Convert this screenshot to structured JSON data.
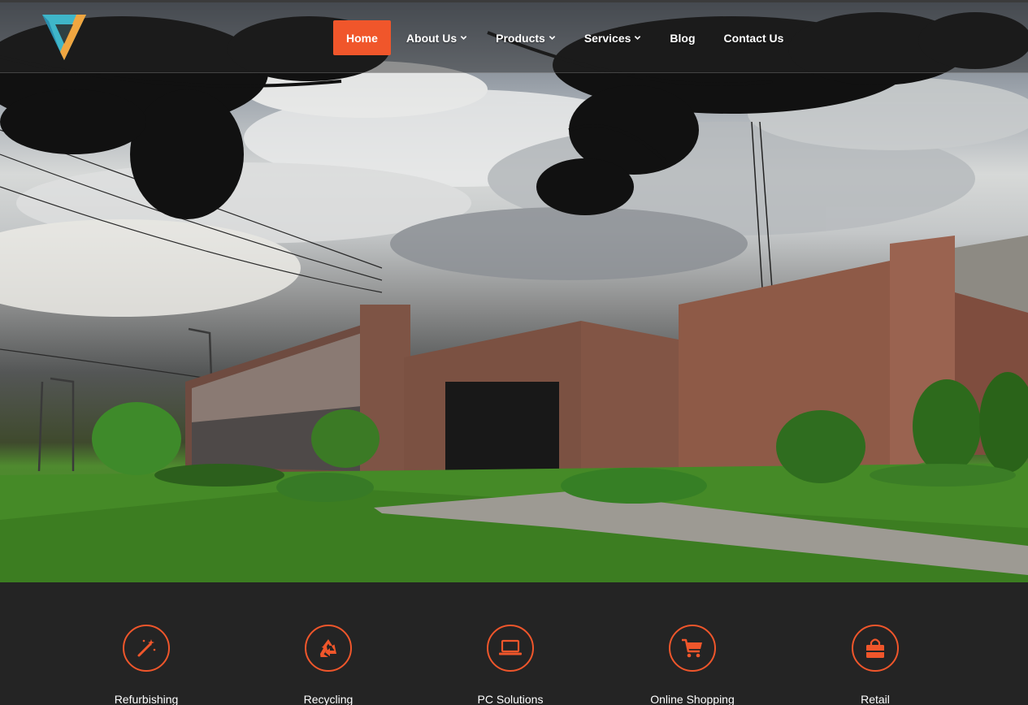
{
  "header": {
    "logo_icon": "v-triangle-logo",
    "nav": [
      {
        "label": "Home",
        "active": true,
        "dropdown": false
      },
      {
        "label": "About Us",
        "active": false,
        "dropdown": true
      },
      {
        "label": "Products",
        "active": false,
        "dropdown": true
      },
      {
        "label": "Services",
        "active": false,
        "dropdown": true
      },
      {
        "label": "Blog",
        "active": false,
        "dropdown": false
      },
      {
        "label": "Contact Us",
        "active": false,
        "dropdown": false
      }
    ]
  },
  "hero": {
    "image": "building-exterior-photo"
  },
  "services": [
    {
      "label": "Refurbishing",
      "icon": "magic-wand-icon"
    },
    {
      "label": "Recycling",
      "icon": "recycle-icon"
    },
    {
      "label": "PC Solutions",
      "icon": "laptop-icon"
    },
    {
      "label": "Online Shopping",
      "icon": "shopping-cart-icon"
    },
    {
      "label": "Retail",
      "icon": "shopping-bag-icon"
    }
  ],
  "colors": {
    "accent": "#f0562b",
    "background_dark": "#242424",
    "nav_text": "#ffffff"
  }
}
